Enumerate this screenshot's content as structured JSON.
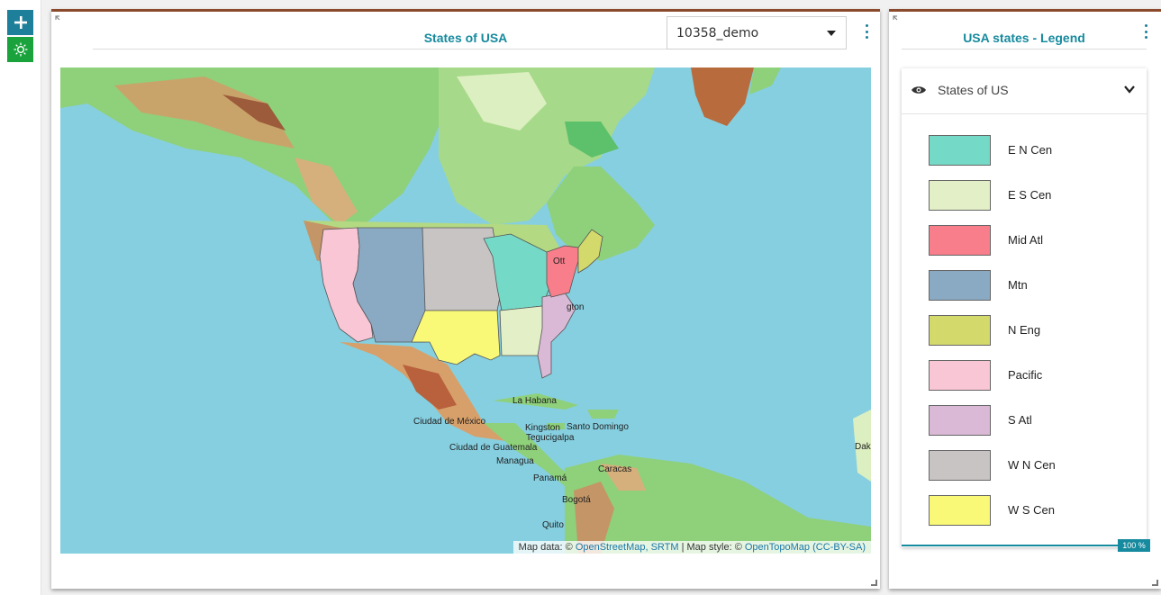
{
  "toolbar": {
    "add_icon": "plus-icon",
    "theme_icon": "sun-icon"
  },
  "map_panel": {
    "title": "States of USA",
    "layer_select": {
      "value": "10358_demo"
    },
    "attribution": {
      "prefix": "Map data: ©",
      "osm_link": "OpenStreetMap, SRTM",
      "sep": "| Map style: ©",
      "otm_link": "OpenTopoMap",
      "license": "(CC-BY-SA)"
    },
    "cities": [
      {
        "name": "La Habana"
      },
      {
        "name": "Ciudad de México"
      },
      {
        "name": "Kingston"
      },
      {
        "name": "Santo Domingo"
      },
      {
        "name": "Tegucigalpa"
      },
      {
        "name": "Ciudad de Guatemala"
      },
      {
        "name": "Managua"
      },
      {
        "name": "Panamá"
      },
      {
        "name": "Caracas"
      },
      {
        "name": "Bogotá"
      },
      {
        "name": "Quito"
      },
      {
        "name": "Ott"
      },
      {
        "name": "gton"
      },
      {
        "name": "Dak"
      }
    ]
  },
  "legend_panel": {
    "title": "USA states - Legend",
    "layer_name": "States of US",
    "items": [
      {
        "label": "E N Cen",
        "color": "#74d9c6"
      },
      {
        "label": "E S Cen",
        "color": "#e3efc6"
      },
      {
        "label": "Mid Atl",
        "color": "#f77e8a"
      },
      {
        "label": "Mtn",
        "color": "#8aa9c3"
      },
      {
        "label": "N Eng",
        "color": "#d4d96b"
      },
      {
        "label": "Pacific",
        "color": "#f8c6d4"
      },
      {
        "label": "S Atl",
        "color": "#d9b9d6"
      },
      {
        "label": "W N Cen",
        "color": "#c8c4c4"
      },
      {
        "label": "W S Cen",
        "color": "#f9f977"
      }
    ],
    "progress": {
      "label": "100 %",
      "value": 100
    }
  }
}
